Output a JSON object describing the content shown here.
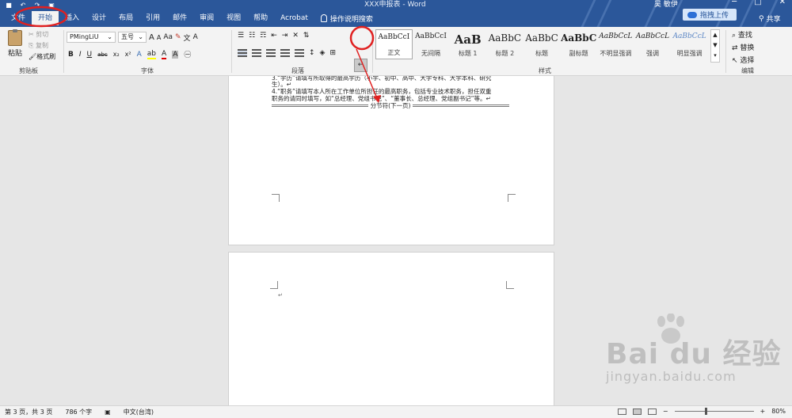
{
  "window": {
    "title": "XXX申报表 - Word",
    "user": "吴 敏伊",
    "controls": [
      "─",
      "□",
      "✕"
    ]
  },
  "qat": [
    "save-icon",
    "undo-icon",
    "redo-icon",
    "print-preview-icon"
  ],
  "tabs": [
    "文件",
    "开始",
    "插入",
    "设计",
    "布局",
    "引用",
    "邮件",
    "审阅",
    "视图",
    "帮助",
    "Acrobat"
  ],
  "active_tab": "开始",
  "tell_me": "操作说明搜索",
  "upload_button": "拖拽上传",
  "share": "共享",
  "ribbon": {
    "clipboard": {
      "label": "剪贴板",
      "paste": "粘贴",
      "cut": "剪切",
      "copy": "复制",
      "format_painter": "格式刷"
    },
    "font": {
      "label": "字体",
      "font_name": "PMingLiU",
      "font_size": "五号",
      "grow": "A",
      "shrink": "A",
      "case": "Aa",
      "bold": "B",
      "italic": "I",
      "underline": "U",
      "strike": "abc",
      "subscript": "x₂",
      "superscript": "x²",
      "font_color": "A",
      "highlight_color": "#ffff00",
      "font_color_value": "#e00000"
    },
    "paragraph": {
      "label": "段落",
      "show_marks": "↵"
    },
    "styles": {
      "label": "样式",
      "items": [
        {
          "preview": "AaBbCcI",
          "name": "正文",
          "selected": true
        },
        {
          "preview": "AaBbCcI",
          "name": "无间隔",
          "selected": false
        },
        {
          "preview": "AaB",
          "name": "标题 1",
          "selected": false
        },
        {
          "preview": "AaBbC",
          "name": "标题 2",
          "selected": false
        },
        {
          "preview": "AaBbC",
          "name": "标题",
          "selected": false
        },
        {
          "preview": "AaBbC",
          "name": "副标题",
          "selected": false
        },
        {
          "preview": "AaBbCcL",
          "name": "不明显强调",
          "selected": false
        },
        {
          "preview": "AaBbCcL",
          "name": "强调",
          "selected": false
        },
        {
          "preview": "AaBbCcL",
          "name": "明显强调",
          "selected": false
        }
      ]
    },
    "editing": {
      "label": "编辑",
      "find": "查找",
      "replace": "替换",
      "select": "选择"
    }
  },
  "document": {
    "page1_lines": [
      "3.“学历”请填写所取得的最高学历（小学、初中、高中、大学专科、大学本科、研究",
      "生）。↵",
      "4.“职务”请填写本人所在工作单位所担任的最高职务，包括专业技术职务，担任双重",
      "职务的请同时填写，如“总经理、党组书记”、“董事长、总经理、党组副书记”等。↵"
    ],
    "section_break": "分节符(下一页)",
    "page2_mark": "↵"
  },
  "status": {
    "page": "第 3 页，共 3 页",
    "words": "786 个字",
    "language": "中文(台湾)",
    "zoom": "80%",
    "zoom_level": 0.8
  },
  "watermark": {
    "main": "Bai du 经验",
    "sub": "jingyan.baidu.com"
  },
  "colors": {
    "titlebar": "#2b579a",
    "annotation": "#e02020"
  }
}
